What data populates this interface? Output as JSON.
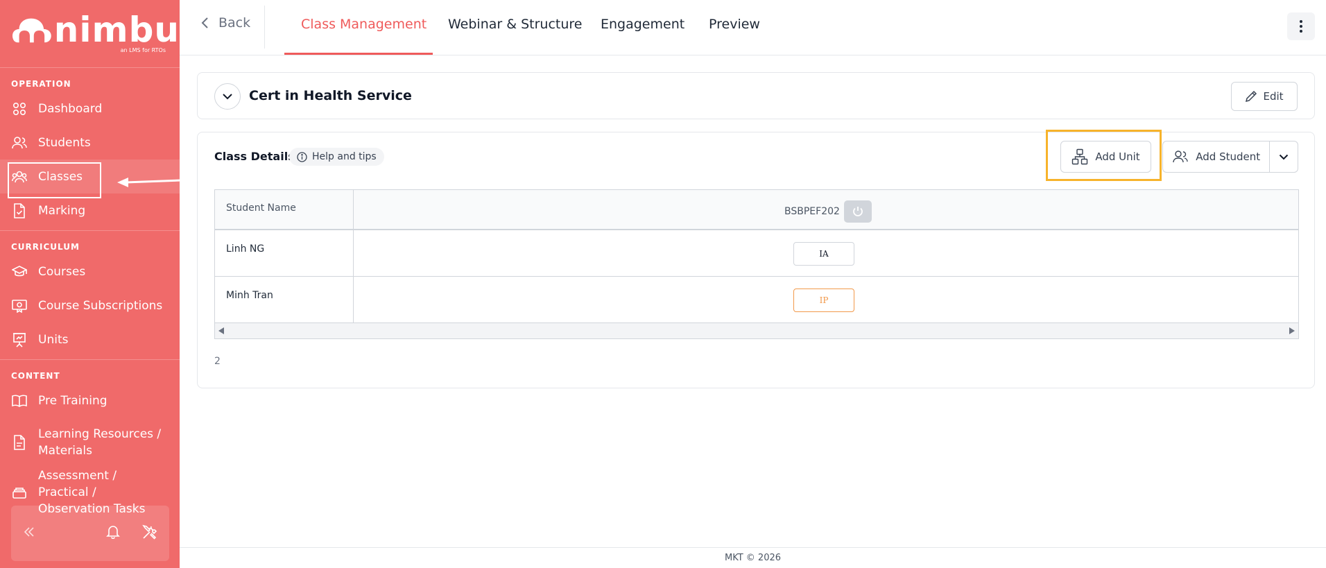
{
  "brand": {
    "name": "nimbu",
    "tagline": "an LMS for RTOs"
  },
  "sidebar": {
    "sections": [
      {
        "label": "OPERATION",
        "items": [
          {
            "label": "Dashboard",
            "icon": "grid-icon"
          },
          {
            "label": "Students",
            "icon": "users-icon"
          },
          {
            "label": "Classes",
            "icon": "group-icon",
            "active": true
          },
          {
            "label": "Marking",
            "icon": "doc-check-icon"
          }
        ]
      },
      {
        "label": "CURRICULUM",
        "items": [
          {
            "label": "Courses",
            "icon": "graduation-cap-icon"
          },
          {
            "label": "Course Subscriptions",
            "icon": "certificate-icon"
          },
          {
            "label": "Units",
            "icon": "presentation-icon"
          }
        ]
      },
      {
        "label": "CONTENT",
        "items": [
          {
            "label": "Pre Training",
            "icon": "book-icon"
          },
          {
            "label": "Learning Resources / Materials",
            "icon": "file-icon"
          },
          {
            "label": "Assessment / Practical / Observation Tasks",
            "icon": "layers-icon"
          }
        ]
      }
    ]
  },
  "topbar": {
    "back_label": "Back",
    "tabs": [
      {
        "label": "Class Management",
        "active": true
      },
      {
        "label": "Webinar & Structure"
      },
      {
        "label": "Engagement"
      },
      {
        "label": "Preview"
      }
    ]
  },
  "course": {
    "title": "Cert in Health Service",
    "edit_label": "Edit"
  },
  "class_details": {
    "title": "Class Details",
    "help_label": "Help and tips",
    "add_unit_label": "Add Unit",
    "add_student_label": "Add Student",
    "table": {
      "name_header": "Student Name",
      "unit_header": "BSBPEF202",
      "rows": [
        {
          "name": "Linh NG",
          "status": "IA"
        },
        {
          "name": "Minh Tran",
          "status": "IP"
        }
      ]
    },
    "count": "2"
  },
  "footer": {
    "text": "MKT © 2026"
  },
  "colors": {
    "sidebar": "#f06a6a",
    "accent": "#ef5b5b",
    "highlight": "#f7b32b",
    "in_progress": "#f2994a"
  }
}
